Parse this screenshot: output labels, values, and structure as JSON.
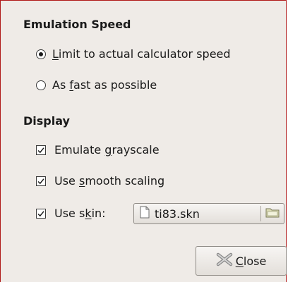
{
  "emulation_speed": {
    "heading": "Emulation Speed",
    "limit_option": {
      "mnemonic": "L",
      "rest": "imit to actual calculator speed",
      "selected": true
    },
    "fast_option": {
      "pre": "As ",
      "mnemonic": "f",
      "rest": "ast as possible",
      "selected": false
    }
  },
  "display": {
    "heading": "Display",
    "grayscale": {
      "pre": "Emulate ",
      "mnemonic": "g",
      "rest": "rayscale",
      "checked": true
    },
    "smooth_scaling": {
      "pre": "Use ",
      "mnemonic": "s",
      "rest": "mooth scaling",
      "checked": true
    },
    "skin": {
      "pre": "Use s",
      "mnemonic": "k",
      "rest": "in:",
      "checked": true,
      "file": "ti83.skn"
    }
  },
  "close_button": {
    "mnemonic": "C",
    "rest": "lose"
  },
  "icons": {
    "skin_file": "document-icon",
    "skin_browse": "folder-icon",
    "close": "close-x-icon"
  },
  "colors": {
    "dialog_bg": "#efebe7",
    "border": "#b01818"
  }
}
